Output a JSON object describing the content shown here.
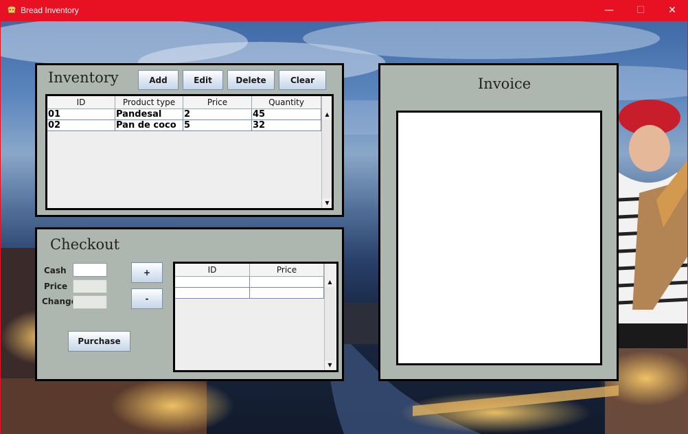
{
  "window": {
    "title": "Bread Inventory",
    "minimize": "—",
    "maximize": "☐",
    "close": "✕"
  },
  "inventory": {
    "heading": "Inventory",
    "buttons": {
      "add": "Add",
      "edit": "Edit",
      "delete": "Delete",
      "clear": "Clear"
    },
    "columns": [
      "ID",
      "Product type",
      "Price",
      "Quantity"
    ],
    "rows": [
      [
        "01",
        "Pandesal",
        "2",
        "45"
      ],
      [
        "02",
        "Pan de coco",
        "5",
        "32"
      ]
    ]
  },
  "checkout": {
    "heading": "Checkout",
    "labels": {
      "cash": "Cash",
      "price": "Price",
      "change": "Change"
    },
    "fields": {
      "cash": "",
      "price": "",
      "change": ""
    },
    "buttons": {
      "plus": "+",
      "minus": "-",
      "purchase": "Purchase"
    },
    "columns": [
      "ID",
      "Price"
    ],
    "rows": [
      [
        "",
        ""
      ],
      [
        "",
        ""
      ]
    ]
  },
  "invoice": {
    "heading": "Invoice",
    "content": ""
  },
  "icons": {
    "app": "bread-icon",
    "scroll_up": "▲",
    "scroll_down": "▼"
  },
  "colors": {
    "titlebar": "#e81123",
    "panel": "#aeb7af"
  }
}
